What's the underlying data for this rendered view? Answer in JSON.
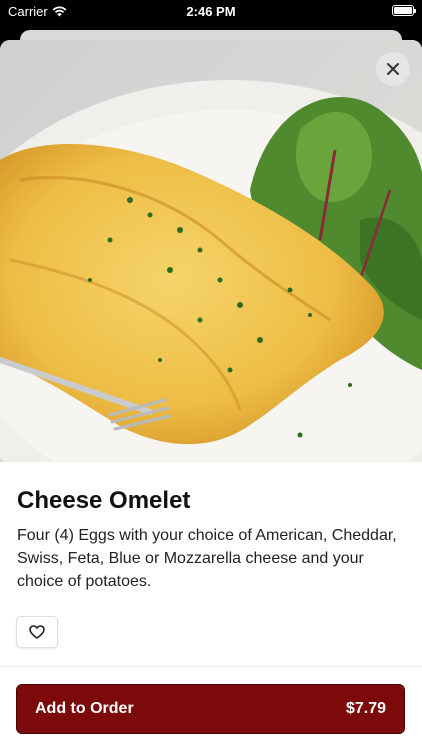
{
  "status_bar": {
    "carrier": "Carrier",
    "time": "2:46 PM",
    "wifi_icon": "wifi-icon",
    "battery_icon": "battery-icon"
  },
  "item": {
    "image_alt": "Cheese omelet with side salad",
    "title": "Cheese Omelet",
    "description": "Four (4) Eggs with your choice of American, Cheddar, Swiss, Feta, Blue or Mozzarella cheese and your choice of potatoes."
  },
  "actions": {
    "close_icon": "close-icon",
    "favorite_icon": "heart-icon",
    "add_label": "Add to Order",
    "price": "$7.79"
  },
  "colors": {
    "accent": "#7d0a0a",
    "background": "#ffffff",
    "status_bar": "#000000"
  }
}
